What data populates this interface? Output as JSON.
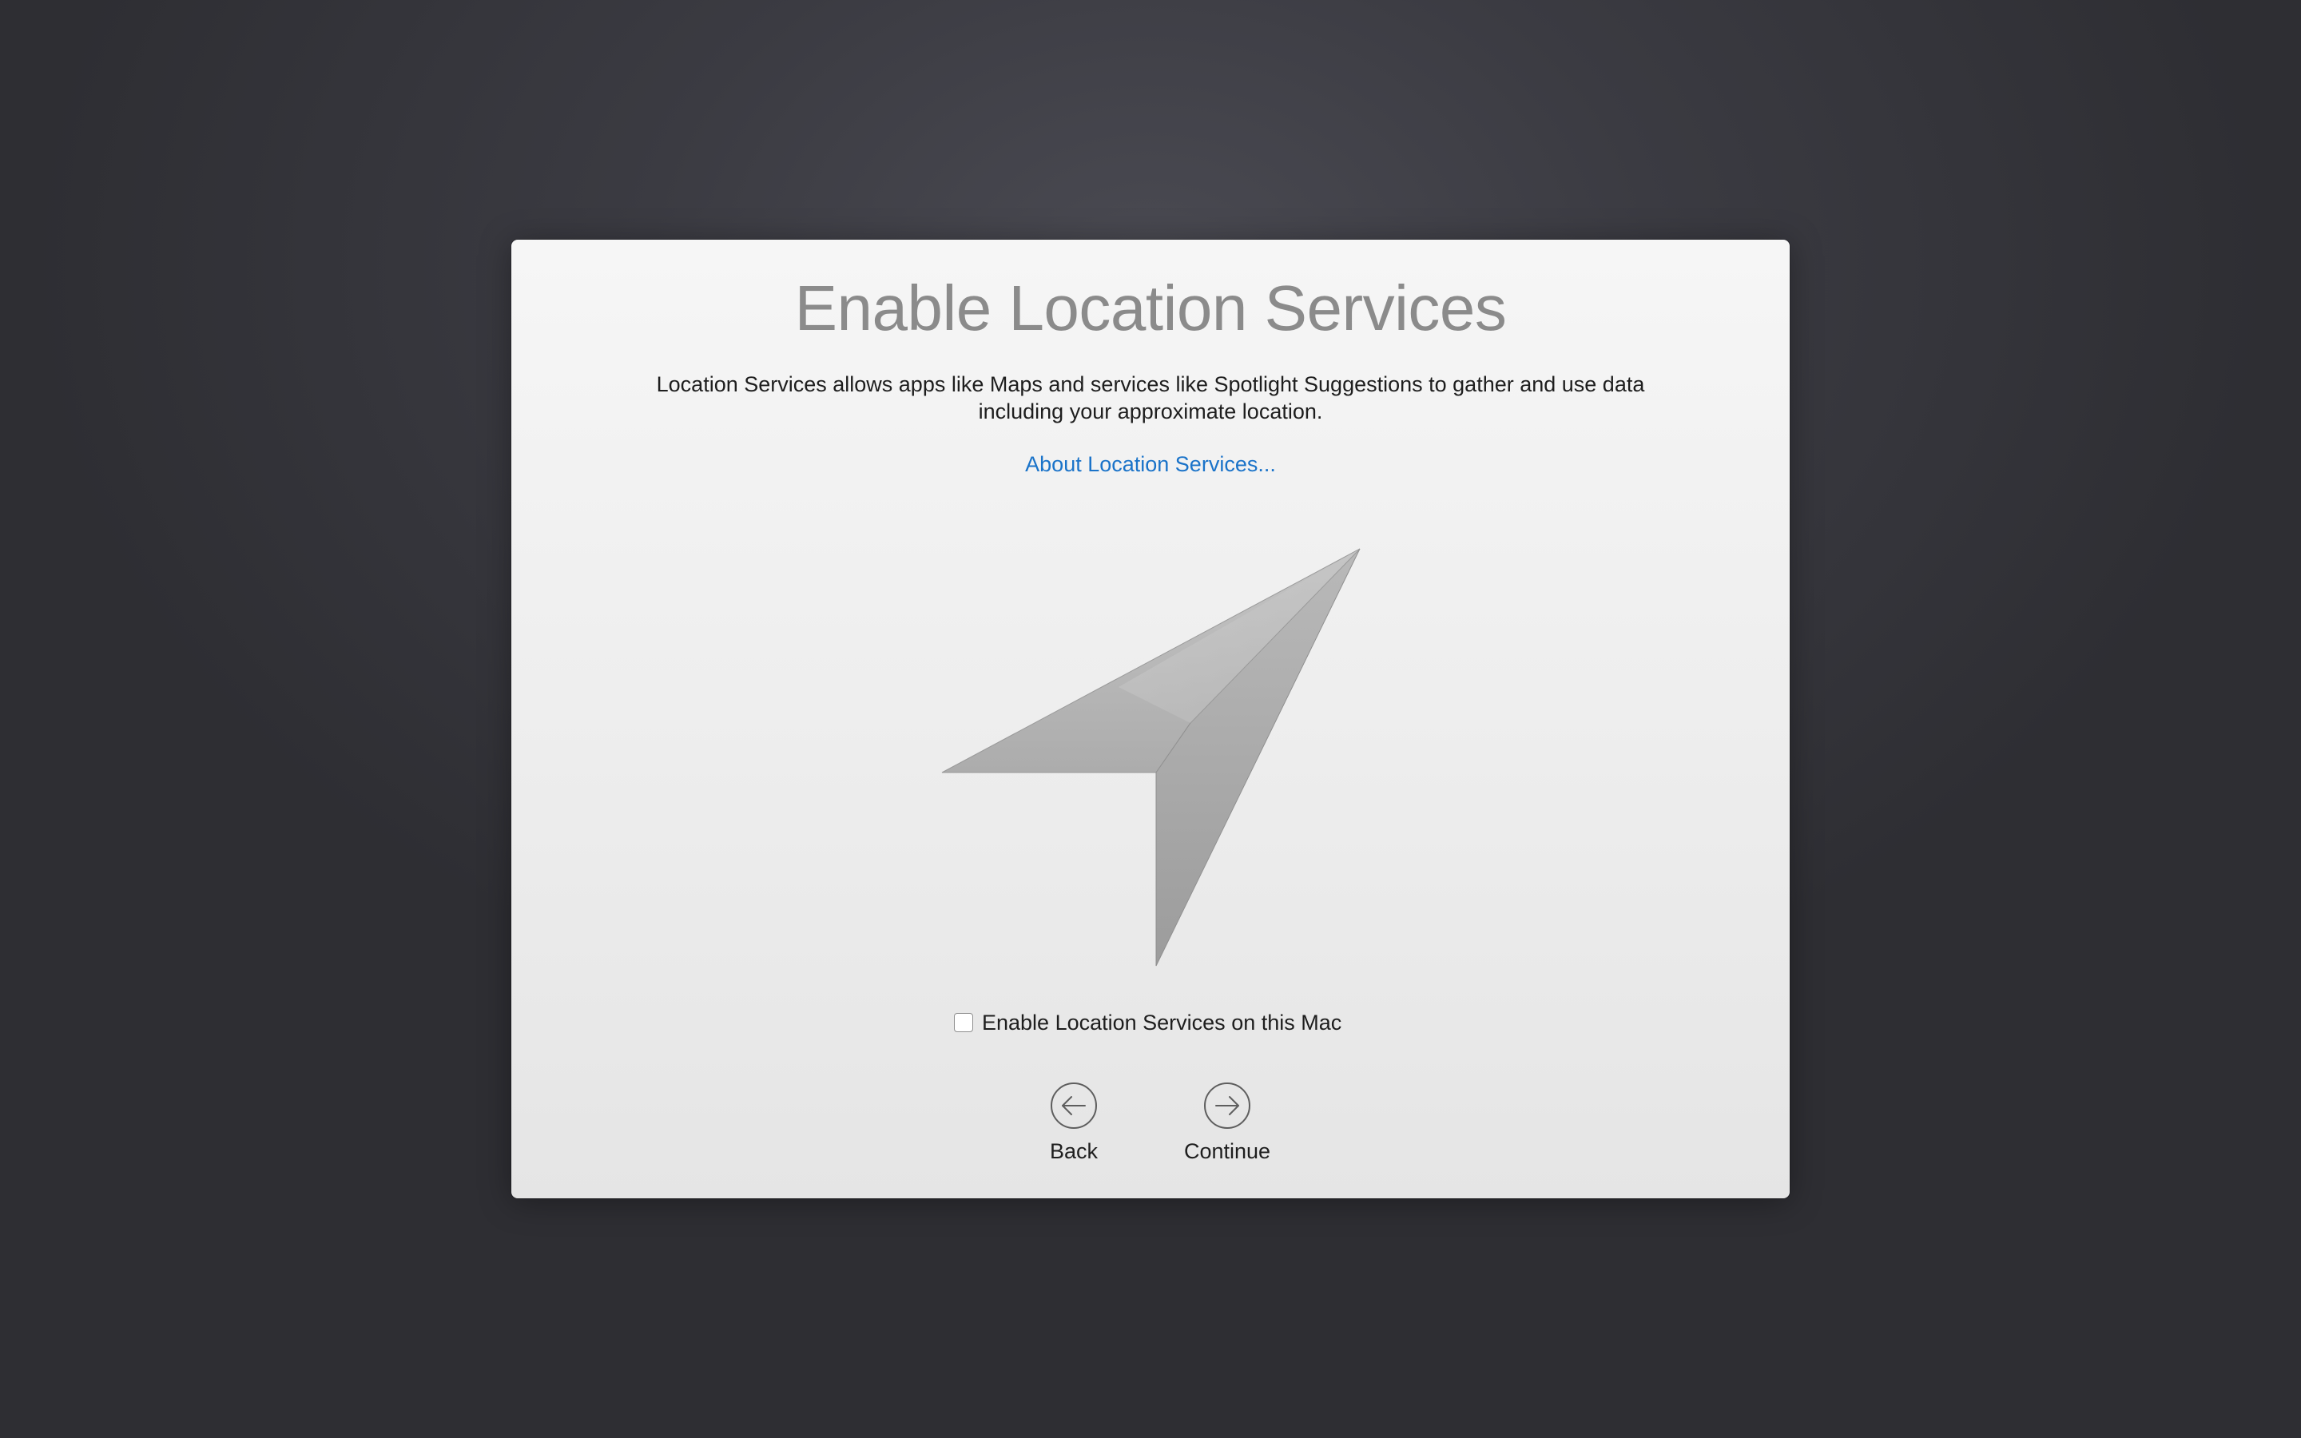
{
  "window": {
    "title": "Enable Location Services",
    "description": "Location Services allows apps like Maps and services like Spotlight Suggestions to gather and use data including your approximate location.",
    "about_link": "About Location Services..."
  },
  "hero": {
    "icon": "location-arrow-icon"
  },
  "checkbox": {
    "label": "Enable Location Services on this Mac",
    "checked": false
  },
  "navigation": {
    "back_label": "Back",
    "back_icon": "arrow-left-circle-icon",
    "continue_label": "Continue",
    "continue_icon": "arrow-right-circle-icon"
  },
  "colors": {
    "link": "#1a73c9",
    "title": "#8b8b8b"
  }
}
